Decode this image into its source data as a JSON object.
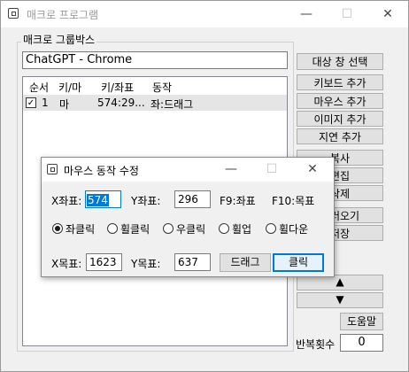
{
  "window": {
    "title": "매크로 프로그램",
    "minimize": "—",
    "maximize": "☐",
    "close": "✕"
  },
  "group": {
    "label": "매크로 그룹박스",
    "window_field": "ChatGPT - Chrome"
  },
  "list": {
    "columns": [
      "순서",
      "키/마",
      "키/좌표",
      "동작"
    ],
    "rows": [
      {
        "checked": true,
        "order": "1",
        "type": "마",
        "coord": "574:29...",
        "action": "좌:드래그"
      }
    ]
  },
  "side_buttons": {
    "select_target": "대상 창 선택",
    "add_keyboard": "키보드 추가",
    "add_mouse": "마우스 추가",
    "add_image": "이미지 추가",
    "add_delay": "지연 추가",
    "copy": "복사",
    "edit": "편집",
    "delete": "삭제",
    "load": "불러오기",
    "save": "저장",
    "up": "▲",
    "down": "▼",
    "help": "도움말",
    "repeat_label": "반복횟수",
    "repeat_value": "0"
  },
  "dialog": {
    "title": "마우스 동작 수정",
    "minimize": "—",
    "maximize": "☐",
    "close": "✕",
    "x_label": "X좌표:",
    "x_value": "574",
    "y_label": "Y좌표:",
    "y_value": "296",
    "f9_hint": "F9:좌표",
    "f10_hint": "F10:목표",
    "radios": [
      {
        "label": "좌클릭",
        "selected": true
      },
      {
        "label": "휠클릭",
        "selected": false
      },
      {
        "label": "우클릭",
        "selected": false
      },
      {
        "label": "휠업",
        "selected": false
      },
      {
        "label": "휠다운",
        "selected": false
      }
    ],
    "tx_label": "X목표:",
    "tx_value": "1623",
    "ty_label": "Y목표:",
    "ty_value": "637",
    "drag_button": "드래그",
    "click_button": "클릭"
  }
}
